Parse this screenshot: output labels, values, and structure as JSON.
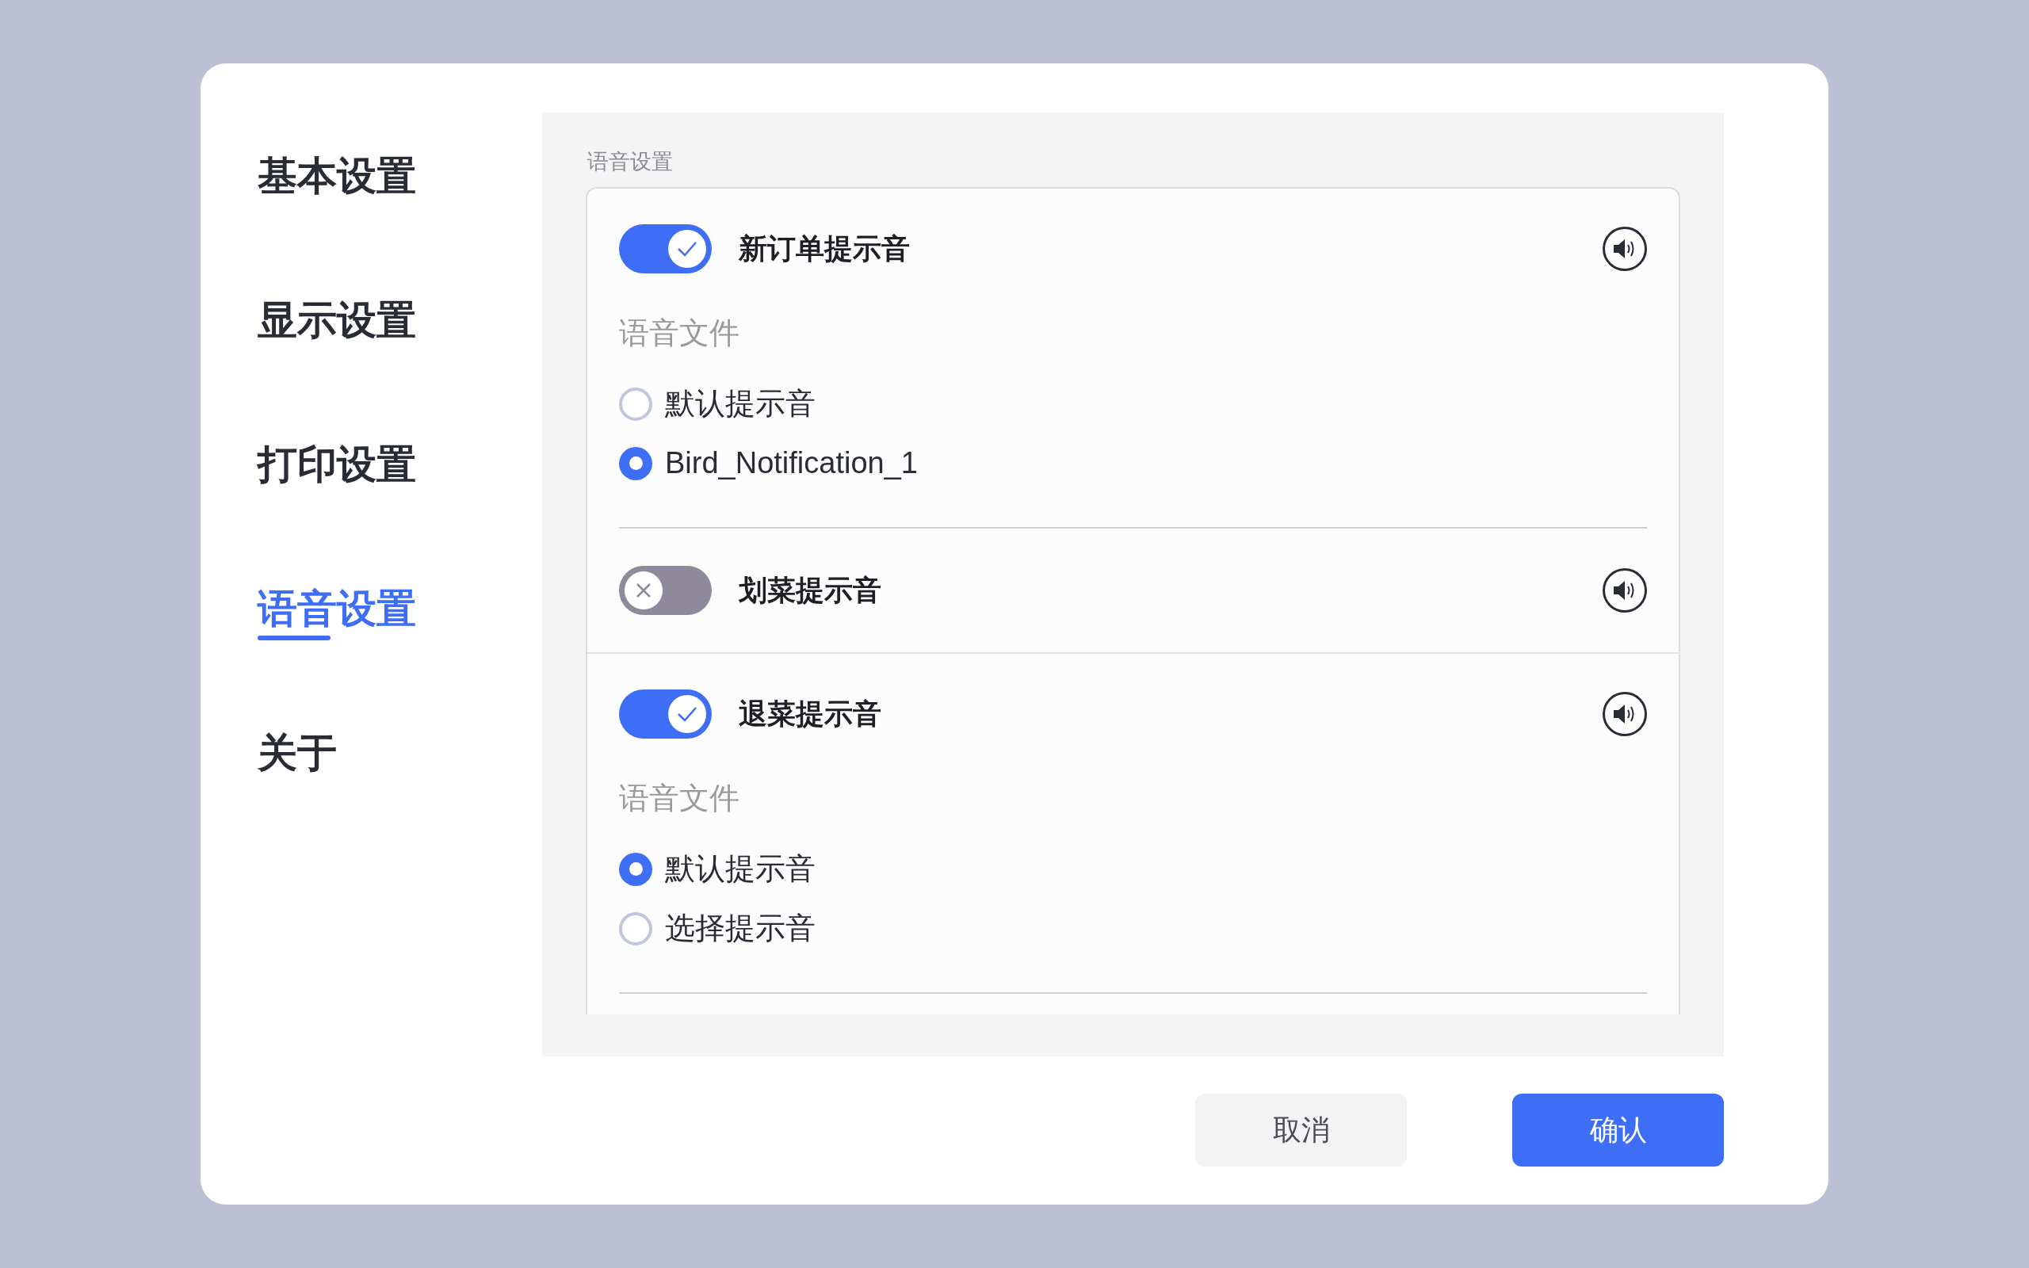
{
  "sidebar": {
    "items": [
      {
        "label": "基本设置",
        "selected": false
      },
      {
        "label": "显示设置",
        "selected": false
      },
      {
        "label": "打印设置",
        "selected": false
      },
      {
        "label": "语音设置",
        "selected": true
      },
      {
        "label": "关于",
        "selected": false
      }
    ]
  },
  "section_title": "语音设置",
  "sound_rows": [
    {
      "title": "新订单提示音",
      "on": true,
      "file_label": "语音文件",
      "options": [
        {
          "label": "默认提示音",
          "selected": false
        },
        {
          "label": "Bird_Notification_1",
          "selected": true
        }
      ]
    },
    {
      "title": "划菜提示音",
      "on": false
    },
    {
      "title": "退菜提示音",
      "on": true,
      "file_label": "语音文件",
      "options": [
        {
          "label": "默认提示音",
          "selected": true
        },
        {
          "label": "选择提示音",
          "selected": false
        }
      ]
    }
  ],
  "buttons": {
    "cancel": "取消",
    "confirm": "确认"
  }
}
